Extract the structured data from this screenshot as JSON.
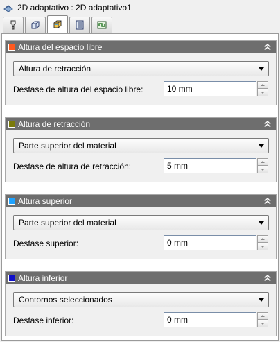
{
  "window": {
    "title": "2D adaptativo : 2D adaptativo1",
    "icon": "toolpath-icon"
  },
  "tabs": [
    {
      "name": "tool-tab",
      "icon": "tool-icon"
    },
    {
      "name": "geometry-tab",
      "icon": "box-geometry-icon"
    },
    {
      "name": "heights-tab",
      "icon": "heights-icon",
      "active": true
    },
    {
      "name": "passes-tab",
      "icon": "passes-icon"
    },
    {
      "name": "linking-tab",
      "icon": "linking-icon"
    }
  ],
  "groups": [
    {
      "title": "Altura del espacio libre",
      "color": "#ff5a1f",
      "dropdown": "Altura de retracción",
      "label": "Desfase de altura del espacio libre:",
      "value": "10 mm"
    },
    {
      "title": "Altura de retracción",
      "color": "#7a7a0a",
      "dropdown": "Parte superior del material",
      "label": "Desfase de altura de retracción:",
      "value": "5 mm"
    },
    {
      "title": "Altura superior",
      "color": "#1fa3ff",
      "dropdown": "Parte superior del material",
      "label": "Desfase superior:",
      "value": "0 mm"
    },
    {
      "title": "Altura inferior",
      "color": "#1010c8",
      "dropdown": "Contornos seleccionados",
      "label": "Desfase inferior:",
      "value": "0 mm"
    }
  ]
}
